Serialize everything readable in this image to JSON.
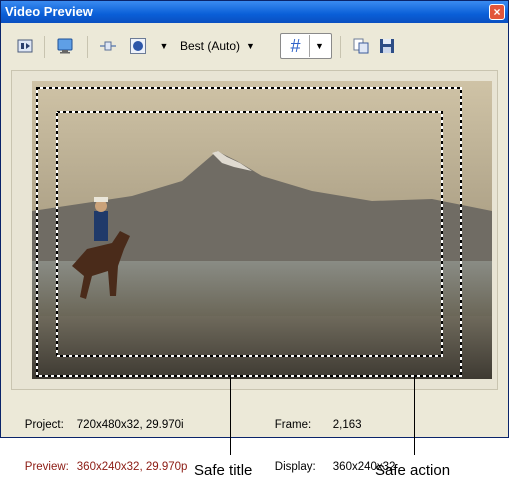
{
  "window": {
    "title": "Video Preview",
    "close_glyph": "×"
  },
  "toolbar": {
    "buttons": [
      {
        "name": "preview-device-icon"
      },
      {
        "name": "monitor-icon"
      },
      {
        "name": "split-screen-icon"
      },
      {
        "name": "overlays-icon"
      },
      {
        "name": "grid-icon"
      },
      {
        "name": "copy-snapshot-icon"
      },
      {
        "name": "save-snapshot-icon"
      }
    ],
    "quality_label": "Best (Auto)",
    "grid_glyph": "#"
  },
  "status": {
    "project_label": "Project:",
    "project_value": "720x480x32, 29.970i",
    "preview_label": "Preview:",
    "preview_value": "360x240x32, 29.970p",
    "frame_label": "Frame:",
    "frame_value": "2,163",
    "display_label": "Display:",
    "display_value": "360x240x32",
    "preview_color": "#8b1a12"
  },
  "callouts": {
    "safe_title": "Safe title",
    "safe_action": "Safe action"
  }
}
